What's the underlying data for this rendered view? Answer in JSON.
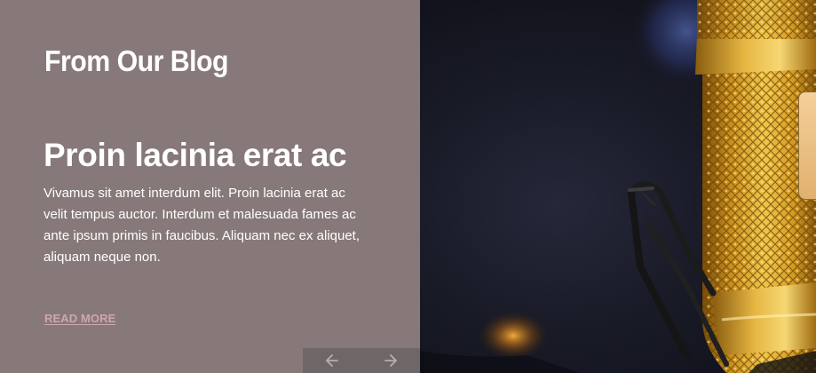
{
  "section": {
    "title": "From Our Blog"
  },
  "post": {
    "title": "Proin lacinia erat ac",
    "excerpt": "Vivamus sit amet interdum elit. Proin lacinia erat ac velit tempus auctor. Interdum et malesuada fames ac ante ipsum primis in faucibus. Aliquam nec ex aliquet, aliquam neque non.",
    "read_more": "READ MORE"
  },
  "slider": {
    "prev_icon": "arrow-left-icon",
    "next_icon": "arrow-right-icon"
  },
  "image": {
    "subject": "microphone-photo"
  },
  "colors": {
    "panel": "#877979",
    "read_more": "#cfa6ad",
    "nav_bg": "#6f6767"
  }
}
